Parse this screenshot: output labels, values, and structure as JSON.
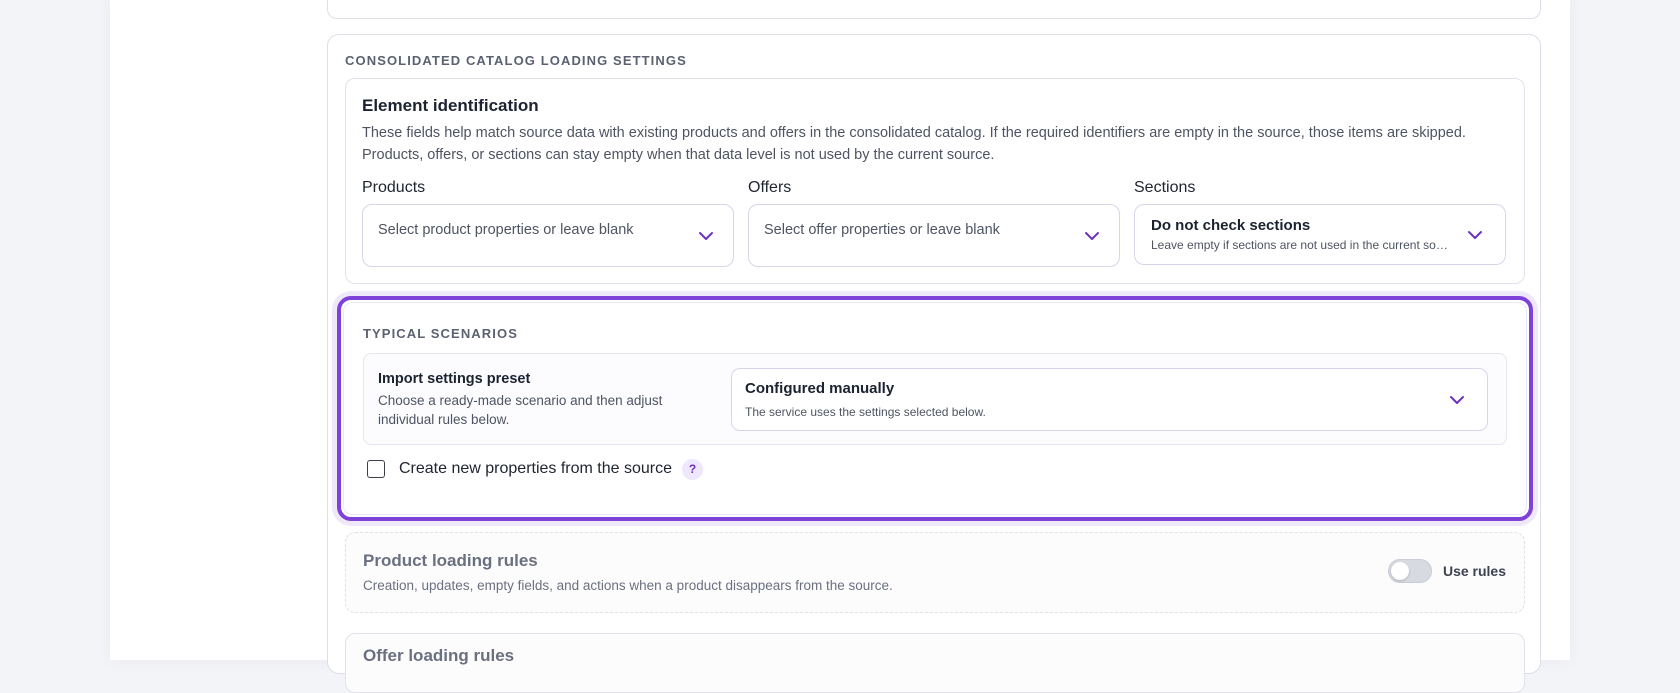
{
  "consolidated": {
    "section_title": "CONSOLIDATED CATALOG LOADING SETTINGS",
    "identification": {
      "title": "Element identification",
      "description": "These fields help match source data with existing products and offers in the consolidated catalog. If the required identifiers are empty in the source, those items are skipped. Products, offers, or sections can stay empty when that data level is not used by the current source.",
      "fields": [
        {
          "label": "Products",
          "placeholder": "Select product properties or leave blank"
        },
        {
          "label": "Offers",
          "placeholder": "Select offer properties or leave blank"
        },
        {
          "label": "Sections",
          "value": "Do not check sections",
          "subtext": "Leave empty if sections are not used in the current source."
        }
      ]
    }
  },
  "scenarios": {
    "title": "TYPICAL SCENARIOS",
    "preset": {
      "title": "Import settings preset",
      "description": "Choose a ready-made scenario and then adjust individual rules below.",
      "value": "Configured manually",
      "subtext": "The service uses the settings selected below."
    },
    "create_properties": {
      "label": "Create new properties from the source",
      "checked": false,
      "help": "?"
    }
  },
  "product_rules": {
    "title": "Product loading rules",
    "description": "Creation, updates, empty fields, and actions when a product disappears from the source.",
    "toggle_label": "Use rules",
    "enabled": false
  },
  "offer_rules": {
    "title": "Offer loading rules"
  },
  "colors": {
    "accent": "#7e42d8",
    "accent_soft": "#efe7fd"
  },
  "icons": {
    "chevron": "chevron-down-icon",
    "help": "question-icon"
  }
}
